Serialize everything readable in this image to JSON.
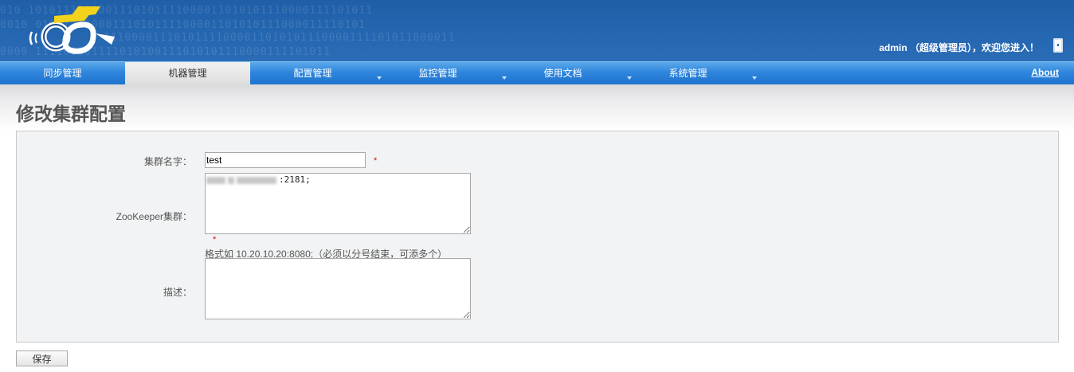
{
  "header": {
    "binary_lines": [
      "010 1010111100001110101111000011010101110000111101011",
      "0010 01011110000111010111100001101010111000011110101",
      "11100001110101111000011010101110000111101011000011",
      "0000 111100001111010100111010101110000111101011"
    ],
    "user_info": "admin （超级管理员），欢迎您进入！"
  },
  "nav": {
    "items": [
      {
        "label": "同步管理",
        "active": false,
        "dropdown": false
      },
      {
        "label": "机器管理",
        "active": true,
        "dropdown": false
      },
      {
        "label": "配置管理",
        "active": false,
        "dropdown": true
      },
      {
        "label": "监控管理",
        "active": false,
        "dropdown": true
      },
      {
        "label": "使用文档",
        "active": false,
        "dropdown": true
      },
      {
        "label": "系统管理",
        "active": false,
        "dropdown": true
      }
    ],
    "about": "About"
  },
  "page": {
    "title": "修改集群配置"
  },
  "form": {
    "cluster_name_label": "集群名字：",
    "cluster_name_value": "test",
    "required_mark": "*",
    "zookeeper_label": "ZooKeeper集群：",
    "zookeeper_value_suffix": ":2181;",
    "zookeeper_hint": "格式如 10.20.10.20:8080;（必须以分号结束，可添多个）",
    "description_label": "描述：",
    "description_value": ""
  },
  "buttons": {
    "save": "保存"
  },
  "colors": {
    "header_blue": "#2466b0",
    "nav_blue": "#2f86dd",
    "required_red": "#d01010"
  }
}
